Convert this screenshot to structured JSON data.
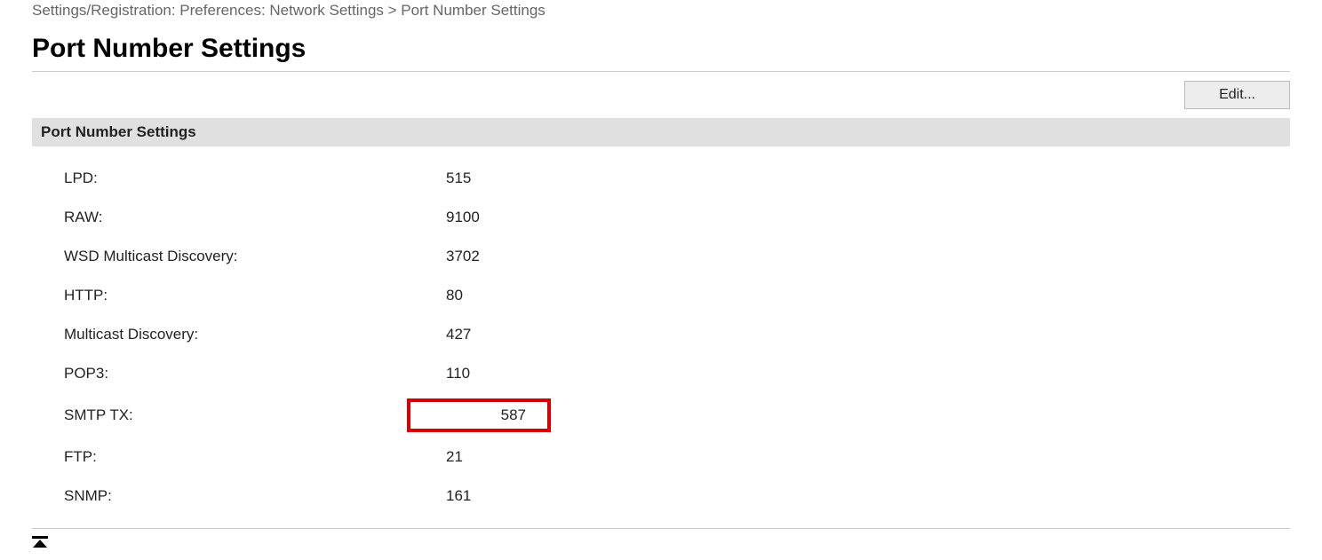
{
  "breadcrumb": "Settings/Registration: Preferences: Network Settings > Port Number Settings",
  "title": "Port Number Settings",
  "edit_label": "Edit...",
  "section_header": "Port Number Settings",
  "settings": [
    {
      "label": "LPD:",
      "value": "515",
      "highlighted": false
    },
    {
      "label": "RAW:",
      "value": "9100",
      "highlighted": false
    },
    {
      "label": "WSD Multicast Discovery:",
      "value": "3702",
      "highlighted": false
    },
    {
      "label": "HTTP:",
      "value": "80",
      "highlighted": false
    },
    {
      "label": "Multicast Discovery:",
      "value": "427",
      "highlighted": false
    },
    {
      "label": "POP3:",
      "value": "110",
      "highlighted": false
    },
    {
      "label": "SMTP TX:",
      "value": "587",
      "highlighted": true
    },
    {
      "label": "FTP:",
      "value": "21",
      "highlighted": false
    },
    {
      "label": "SNMP:",
      "value": "161",
      "highlighted": false
    }
  ]
}
